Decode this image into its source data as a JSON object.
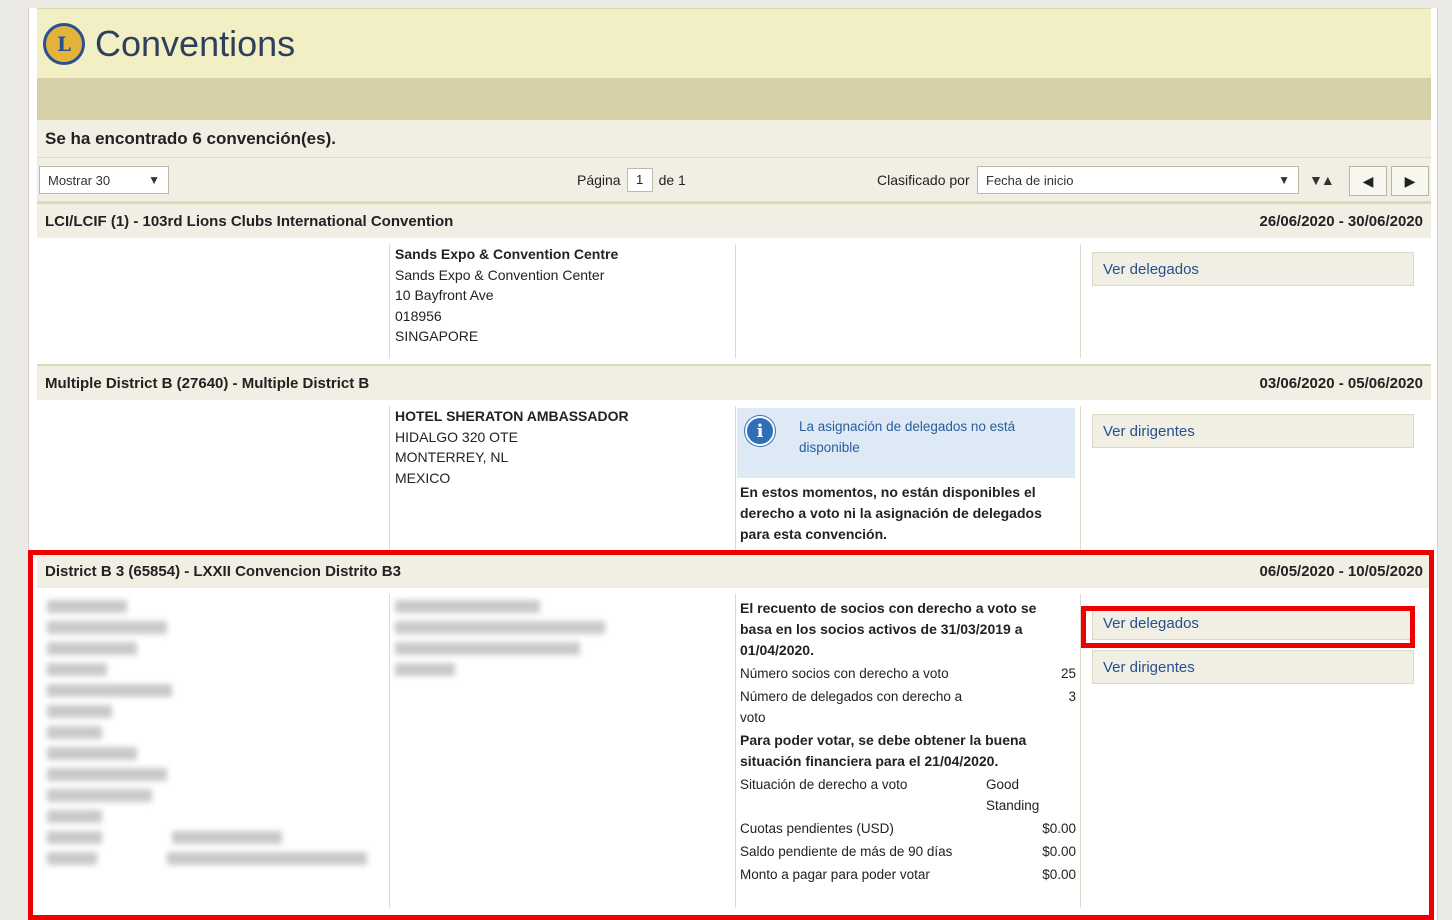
{
  "app": {
    "title": "Conventions",
    "logo_text": "L"
  },
  "results": {
    "found_text": "Se ha encontrado 6 convención(es)."
  },
  "toolbar": {
    "show_select": "Mostrar 30",
    "page_label": "Página",
    "page_value": "1",
    "page_of": "de 1",
    "sort_label": "Clasificado por",
    "sort_select": "Fecha de inicio",
    "sort_icons": "▼▲",
    "prev_icon": "◀",
    "next_icon": "▶"
  },
  "conventions": [
    {
      "title": "LCI/LCIF (1) - 103rd Lions Clubs International Convention",
      "dates": "26/06/2020 - 30/06/2020",
      "venue_name": "Sands Expo & Convention Centre",
      "venue_lines": [
        "Sands Expo & Convention Center",
        "10 Bayfront Ave",
        "018956",
        "SINGAPORE"
      ],
      "button": "Ver delegados"
    },
    {
      "title": "Multiple District B (27640) - Multiple District B",
      "dates": "03/06/2020 - 05/06/2020",
      "venue_name": "HOTEL SHERATON AMBASSADOR",
      "venue_lines": [
        "HIDALGO 320 OTE",
        "MONTERREY, NL",
        "MEXICO"
      ],
      "info_text": "La asignación de delegados no está disponible",
      "notice": "En estos momentos, no están disponibles el derecho a voto ni la asignación de delegados para esta convención.",
      "button": "Ver dirigentes"
    },
    {
      "title": "District B 3 (65854) - LXXII Convencion Distrito B3",
      "dates": "06/05/2020 - 10/05/2020",
      "count_intro": "El recuento de socios con derecho a voto se basa en los socios activos de 31/03/2019 a 01/04/2020.",
      "members_label": "Número socios con derecho a voto",
      "members_value": "25",
      "delegates_label": "Número de delegados con derecho a voto",
      "delegates_value": "3",
      "standing_intro": "Para poder votar, se debe obtener la buena situación financiera para el 21/04/2020.",
      "status_label": "Situación de derecho a voto",
      "status_value": "Good Standing",
      "dues_label": "Cuotas pendientes (USD)",
      "dues_value": "$0.00",
      "balance_label": "Saldo pendiente de más de 90 días",
      "balance_value": "$0.00",
      "pay_label": "Monto a pagar para poder votar",
      "pay_value": "$0.00",
      "button_delegates": "Ver delegados",
      "button_officers": "Ver dirigentes"
    }
  ],
  "colors": {
    "highlight": "#ee0000",
    "link": "#254f8f",
    "header_bg": "#f3efc5"
  }
}
